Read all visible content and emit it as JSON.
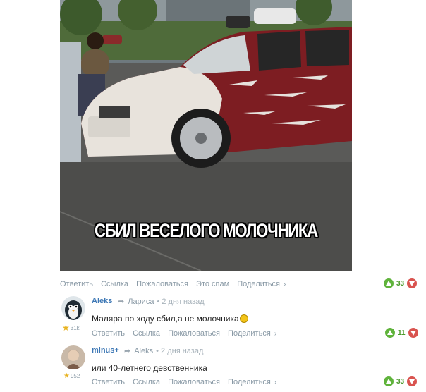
{
  "post": {
    "caption": "СБИЛ ВЕСЕЛОГО МОЛОЧНИКА",
    "actions": {
      "reply": "Ответить",
      "link": "Ссылка",
      "complain": "Пожаловаться",
      "spam": "Это спам",
      "share": "Поделиться",
      "chevron": "›"
    },
    "votes": "33"
  },
  "comments": [
    {
      "author": "Aleks",
      "reply_to": "Лариса",
      "time": "• 2 дня назад",
      "text": "Маляра по ходу сбил,а не молочника",
      "karma": "31k",
      "votes": "11",
      "actions": {
        "reply": "Ответить",
        "link": "Ссылка",
        "complain": "Пожаловаться",
        "share": "Поделиться",
        "chevron": "›"
      }
    },
    {
      "author": "minus+",
      "reply_to": "Aleks",
      "time": "• 2 дня назад",
      "text": "или 40-летнего девственника",
      "karma": "952",
      "votes": "33",
      "actions": {
        "reply": "Ответить",
        "link": "Ссылка",
        "complain": "Пожаловаться",
        "share": "Поделиться",
        "chevron": "›"
      }
    }
  ],
  "icons": {
    "upvote": "upvote-icon",
    "downvote": "downvote-icon",
    "reply_arrow": "reply-arrow-icon",
    "karma_star": "star-icon"
  },
  "colors": {
    "link": "#3c77b5",
    "muted": "#8a9aa6",
    "upvote": "#5fb33b",
    "downvote": "#d9534f",
    "star": "#e8b321"
  }
}
